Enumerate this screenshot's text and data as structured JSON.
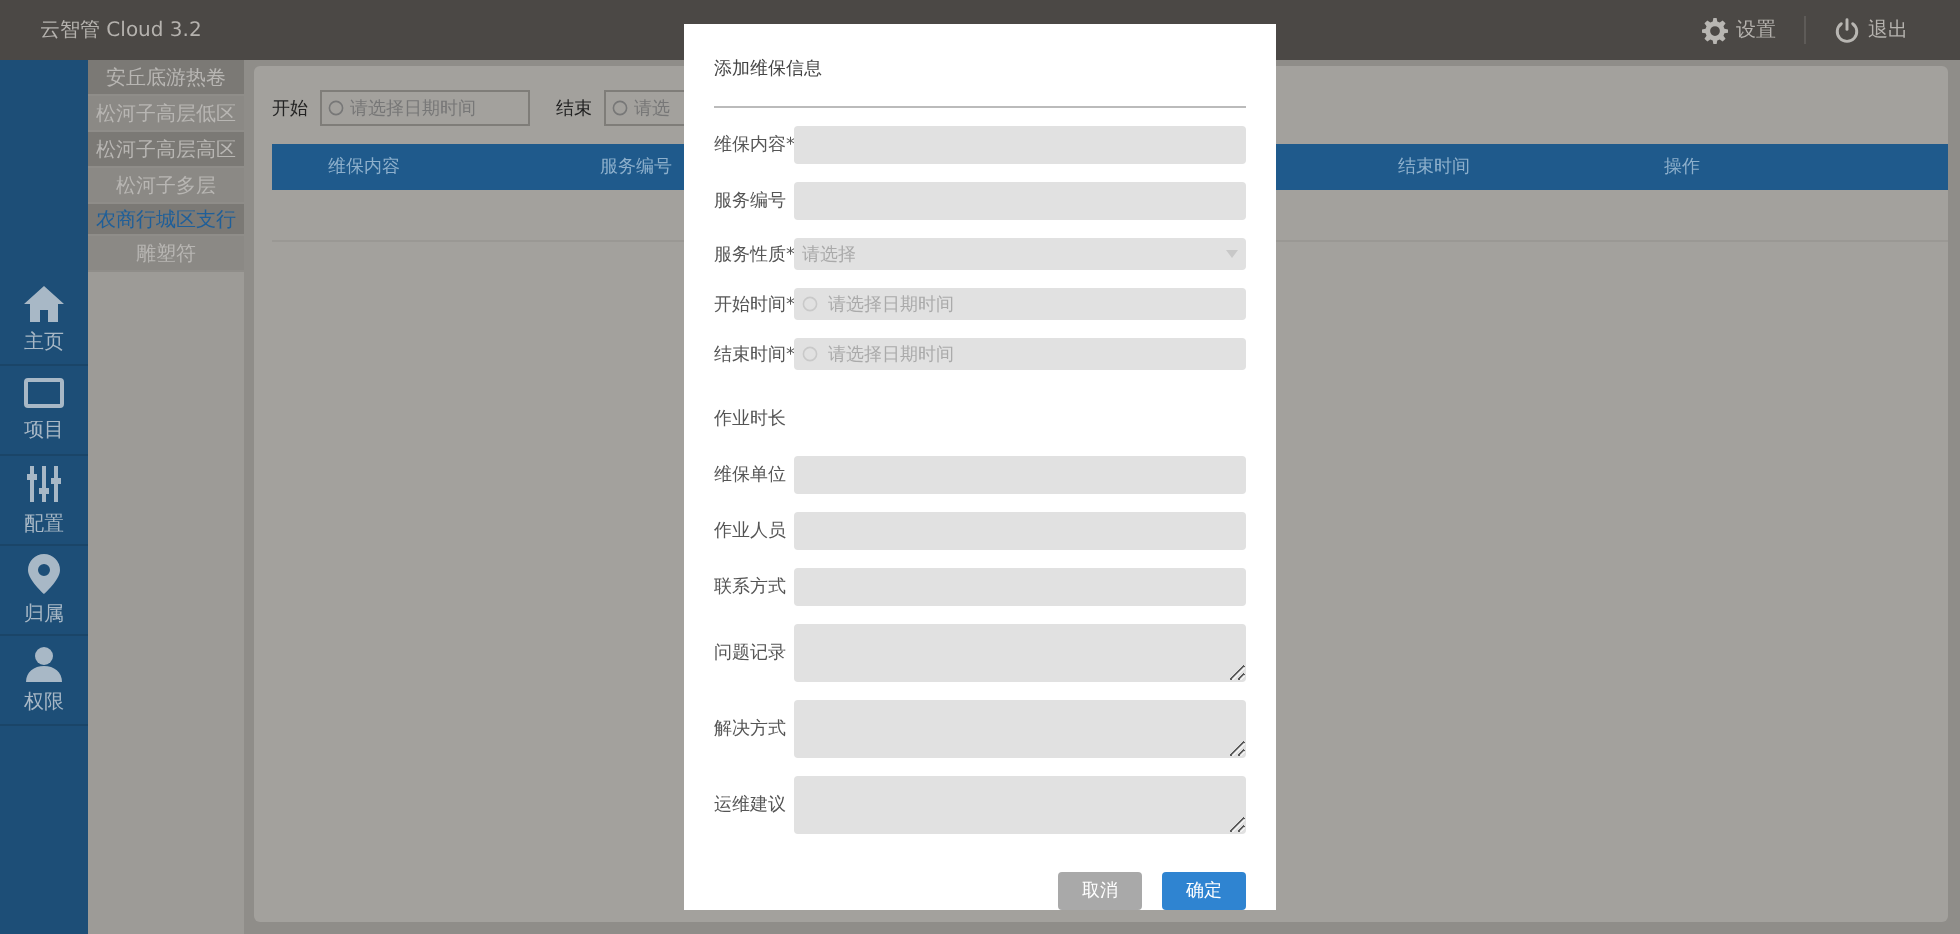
{
  "topbar": {
    "title": "云智管 Cloud 3.2",
    "actions": [
      {
        "label": "设置"
      },
      {
        "label": "退出"
      }
    ]
  },
  "nav": [
    {
      "label": "主页"
    },
    {
      "label": "项目"
    },
    {
      "label": "配置"
    },
    {
      "label": "归属"
    },
    {
      "label": "权限"
    }
  ],
  "submenu": [
    {
      "label": "安丘底游热卷",
      "selected": false
    },
    {
      "label": "松河子高层低区",
      "selected": false
    },
    {
      "label": "松河子高层高区",
      "selected": false
    },
    {
      "label": "松河子多层",
      "selected": false
    },
    {
      "label": "农商行城区支行",
      "selected": true
    },
    {
      "label": "雕塑符",
      "selected": false
    }
  ],
  "filters": [
    {
      "label": "开始",
      "placeholder": "请选择日期时间"
    },
    {
      "label": "结束",
      "placeholder": "请选"
    }
  ],
  "table": {
    "columns": [
      "维保内容",
      "服务编号",
      "结束时间",
      "操作"
    ]
  },
  "modal": {
    "title": "添加维保信息",
    "fields": [
      {
        "kind": "input",
        "label": "维保内容*"
      },
      {
        "kind": "input",
        "label": "服务编号"
      },
      {
        "kind": "select",
        "label": "服务性质*",
        "placeholder": "请选择"
      },
      {
        "kind": "date",
        "label": "开始时间*",
        "placeholder": "请选择日期时间"
      },
      {
        "kind": "date",
        "label": "结束时间*",
        "placeholder": "请选择日期时间"
      },
      {
        "kind": "text",
        "label": "作业时长"
      },
      {
        "kind": "input",
        "label": "维保单位"
      },
      {
        "kind": "input",
        "label": "作业人员"
      },
      {
        "kind": "input",
        "label": "联系方式"
      },
      {
        "kind": "textarea",
        "label": "问题记录"
      },
      {
        "kind": "textarea",
        "label": "解决方式"
      },
      {
        "kind": "textarea",
        "label": "运维建议"
      }
    ],
    "buttons": [
      {
        "kind": "cancel",
        "label": "取消"
      },
      {
        "kind": "primary",
        "label": "确定"
      }
    ]
  }
}
